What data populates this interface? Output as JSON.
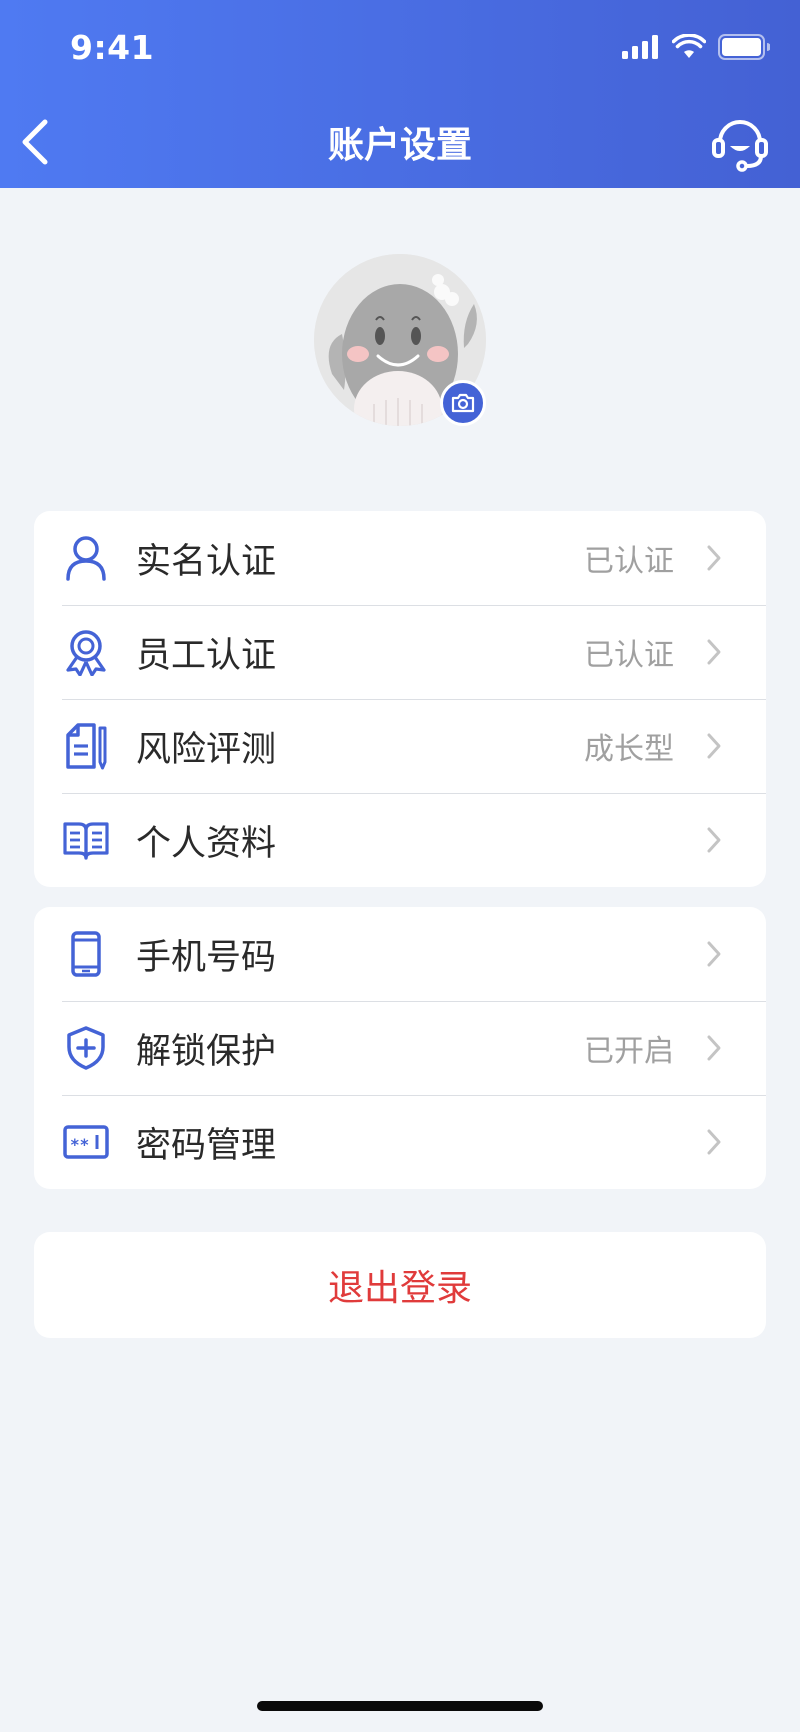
{
  "status_bar": {
    "time": "9:41"
  },
  "nav": {
    "title": "账户设置"
  },
  "groups": [
    {
      "items": [
        {
          "name": "row-real-name",
          "icon": "user-icon",
          "label": "实名认证",
          "value": "已认证"
        },
        {
          "name": "row-employee",
          "icon": "badge-icon",
          "label": "员工认证",
          "value": "已认证"
        },
        {
          "name": "row-risk",
          "icon": "document-pen-icon",
          "label": "风险评测",
          "value": "成长型"
        },
        {
          "name": "row-profile",
          "icon": "book-icon",
          "label": "个人资料",
          "value": ""
        }
      ]
    },
    {
      "items": [
        {
          "name": "row-phone",
          "icon": "phone-icon",
          "label": "手机号码",
          "value": ""
        },
        {
          "name": "row-unlock",
          "icon": "shield-plus-icon",
          "label": "解锁保护",
          "value": "已开启"
        },
        {
          "name": "row-password",
          "icon": "password-icon",
          "label": "密码管理",
          "value": ""
        }
      ]
    }
  ],
  "logout": {
    "label": "退出登录"
  },
  "colors": {
    "accent": "#4463d6",
    "danger": "#e03b3b",
    "background": "#f1f4f8"
  }
}
